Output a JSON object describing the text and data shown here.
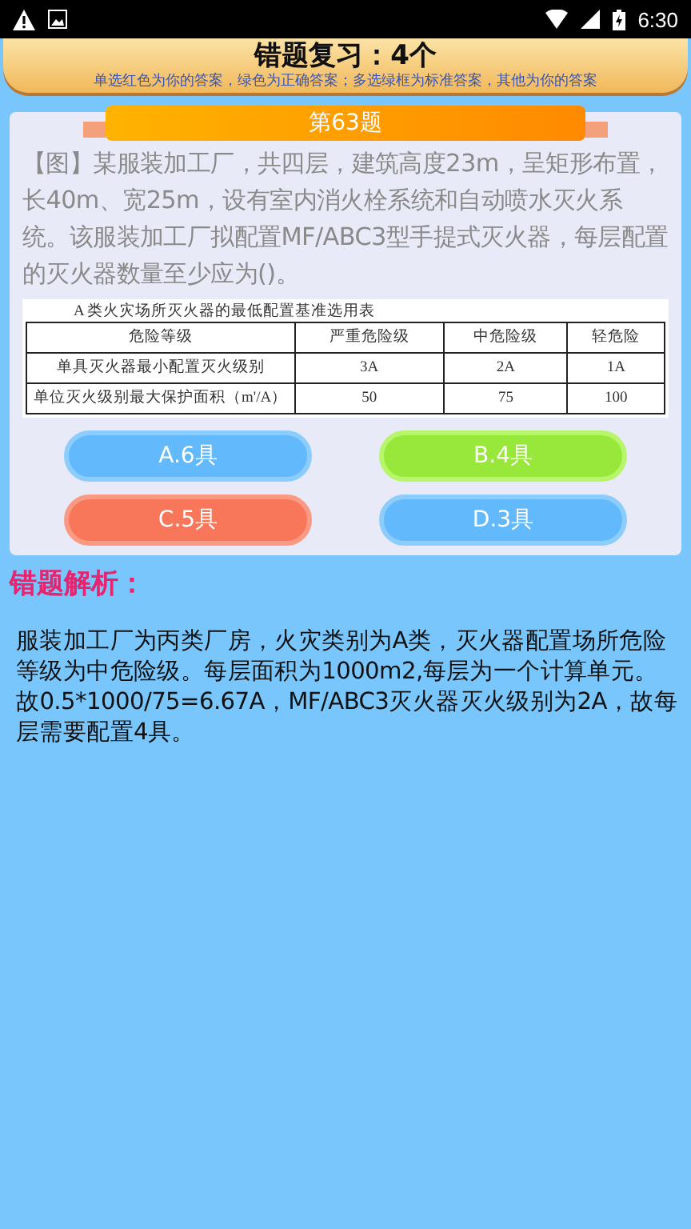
{
  "status_bar": {
    "time": "6:30"
  },
  "header": {
    "title": "错题复习：4个",
    "subtitle": "单选红色为你的答案，绿色为正确答案；多选绿框为标准答案，其他为你的答案"
  },
  "question": {
    "number": "第63题",
    "text": "【图】某服装加工厂，共四层，建筑高度23m，呈矩形布置，长40m、宽25m，设有室内消火栓系统和自动喷水灭火系统。该服装加工厂拟配置MF/ABC3型手提式灭火器，每层配置的灭火器数量至少应为()。",
    "table": {
      "caption": "A 类火灾场所灭火器的最低配置基准选用表",
      "columns": [
        "危险等级",
        "严重危险级",
        "中危险级",
        "轻危险"
      ],
      "rows": [
        [
          "单具灭火器最小配置灭火级别",
          "3A",
          "2A",
          "1A"
        ],
        [
          "单位灭火级别最大保护面积（m'/A）",
          "50",
          "75",
          "100"
        ]
      ]
    },
    "options": [
      {
        "label": "A.6具",
        "kind": "normal"
      },
      {
        "label": "B.4具",
        "kind": "correct"
      },
      {
        "label": "C.5具",
        "kind": "wrong"
      },
      {
        "label": "D.3具",
        "kind": "normal"
      }
    ]
  },
  "analysis": {
    "title": "错题解析：",
    "text": "服装加工厂为丙类厂房，火灾类别为A类，灭火器配置场所危险等级为中危险级。每层面积为1000m2,每层为一个计算单元。故0.5*1000/75=6.67A，MF/ABC3灭火器灭火级别为2A，故每层需要配置4具。"
  }
}
